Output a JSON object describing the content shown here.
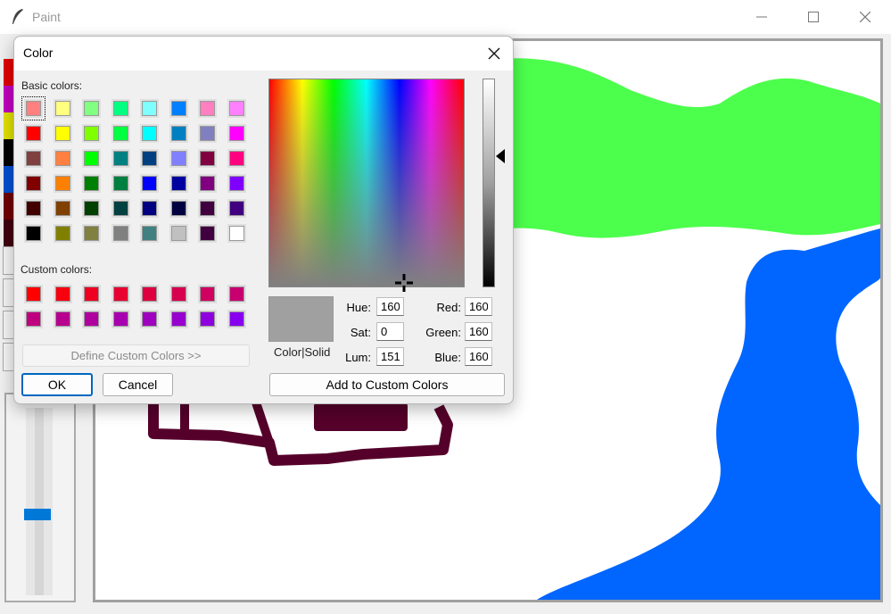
{
  "window": {
    "title": "Paint"
  },
  "dialog": {
    "title": "Color",
    "basic_colors_label": "Basic colors:",
    "custom_colors_label": "Custom colors:",
    "basic_colors": [
      "#ff8080",
      "#ffff80",
      "#80ff80",
      "#00ff80",
      "#80ffff",
      "#0080ff",
      "#ff80c0",
      "#ff80ff",
      "#ff0000",
      "#ffff00",
      "#80ff00",
      "#00ff40",
      "#00ffff",
      "#0080c0",
      "#8080c0",
      "#ff00ff",
      "#804040",
      "#ff8040",
      "#00ff00",
      "#008080",
      "#004080",
      "#8080ff",
      "#800040",
      "#ff0080",
      "#800000",
      "#ff8000",
      "#008000",
      "#008040",
      "#0000ff",
      "#0000a0",
      "#800080",
      "#8000ff",
      "#400000",
      "#804000",
      "#004000",
      "#004040",
      "#000080",
      "#000040",
      "#400040",
      "#400080",
      "#000000",
      "#808000",
      "#808040",
      "#808080",
      "#408080",
      "#c0c0c0",
      "#400040",
      "#ffffff"
    ],
    "selected_basic_index": 0,
    "custom_colors": [
      "#ff0000",
      "#f70010",
      "#ef0020",
      "#e70030",
      "#df0040",
      "#d7004f",
      "#cf005f",
      "#c7006f",
      "#bf007f",
      "#b7008f",
      "#af009f",
      "#a700af",
      "#9f00bf",
      "#9700cf",
      "#8f00df",
      "#8700ef"
    ],
    "define_custom_label": "Define Custom Colors >>",
    "ok_label": "OK",
    "cancel_label": "Cancel",
    "add_custom_label": "Add to Custom Colors",
    "preview_label": "Color|Solid",
    "preview_color": "#a0a0a0",
    "fields": {
      "hue_label": "Hue:",
      "hue_value": "160",
      "sat_label": "Sat:",
      "sat_value": "0",
      "lum_label": "Lum:",
      "lum_value": "151",
      "red_label": "Red:",
      "red_value": "160",
      "green_label": "Green:",
      "green_value": "160",
      "blue_label": "Blue:",
      "blue_value": "160"
    }
  },
  "left_palette": [
    "#ff0000",
    "#c000c0",
    "#ffff00",
    "#000000",
    "#0050d0",
    "#800000",
    "#400000"
  ],
  "canvas": {
    "colors": {
      "green": "#4cff4c",
      "blue": "#0066ff",
      "maroon": "#55002a"
    }
  },
  "icons": {
    "app": "feather-icon",
    "minimize": "minimize-icon",
    "maximize": "maximize-icon",
    "close": "close-icon",
    "dialog_close": "close-icon",
    "crosshair": "crosshair-icon",
    "lum_pointer": "triangle-left-icon"
  }
}
